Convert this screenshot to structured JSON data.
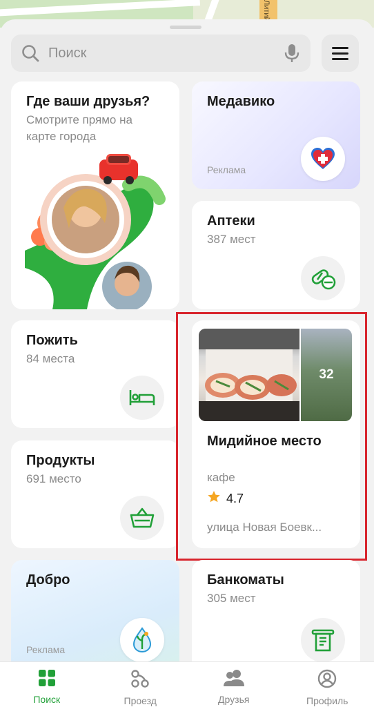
{
  "map": {
    "street_label": "Литий"
  },
  "search": {
    "placeholder": "Поиск"
  },
  "cards": {
    "friends": {
      "title": "Где ваши друзья?",
      "subtitle": "Смотрите прямо на карте города"
    },
    "medavico": {
      "title": "Медавико",
      "ad_label": "Реклама"
    },
    "pharmacies": {
      "title": "Аптеки",
      "count": "387 мест"
    },
    "live": {
      "title": "Пожить",
      "count": "84 места"
    },
    "products": {
      "title": "Продукты",
      "count": "691 место"
    },
    "place": {
      "photo_count": "32",
      "name": "Мидийное место",
      "type": "кафе",
      "rating": "4.7",
      "address": "улица Новая Боевк..."
    },
    "good": {
      "title": "Добро",
      "ad_label": "Реклама"
    },
    "atm": {
      "title": "Банкоматы",
      "count": "305 мест"
    }
  },
  "nav": {
    "items": [
      {
        "label": "Поиск",
        "icon": "grid-icon",
        "active": true
      },
      {
        "label": "Проезд",
        "icon": "route-icon",
        "active": false
      },
      {
        "label": "Друзья",
        "icon": "friends-icon",
        "active": false
      },
      {
        "label": "Профиль",
        "icon": "profile-icon",
        "active": false
      }
    ]
  },
  "colors": {
    "accent": "#21a038",
    "highlight": "#d8252d",
    "rating_star": "#f5a623"
  }
}
